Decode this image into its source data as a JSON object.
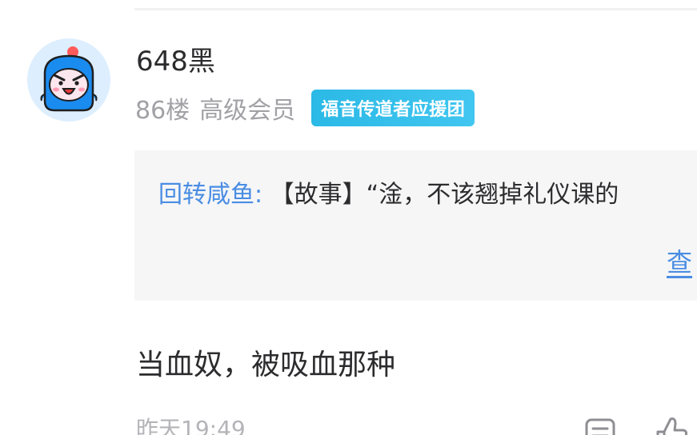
{
  "post": {
    "username": "648黑",
    "floor": "86楼",
    "level": "高级会员",
    "badge": "福音传道者应援团",
    "quote": {
      "author": "回转咸鱼:",
      "text": "【故事】“淦，不该翘掉礼仪课的",
      "more_label": "查"
    },
    "reply_text": "当血奴，被吸血那种",
    "timestamp": "昨天19:49"
  },
  "icons": {
    "avatar": "angry-blue-mascot-avatar",
    "comment": "comment-icon",
    "like": "thumbs-up-icon"
  },
  "colors": {
    "link_blue": "#4a8de3",
    "badge_bg": "#2bb9e6",
    "muted_text": "#a1a1a6",
    "quote_bg": "#f6f6f7"
  }
}
